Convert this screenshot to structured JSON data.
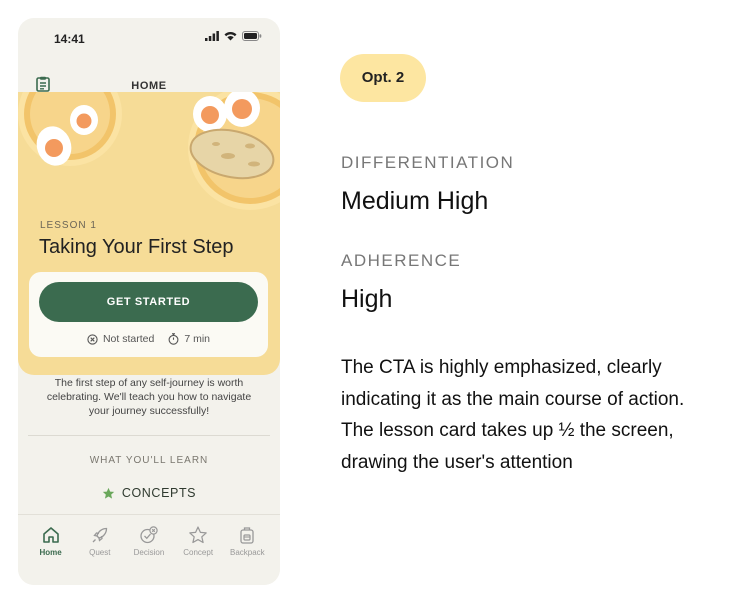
{
  "phone": {
    "status_bar": {
      "time": "14:41"
    },
    "app_bar": {
      "title": "HOME"
    },
    "lesson": {
      "label": "LESSON 1",
      "title": "Taking Your First Step",
      "cta_label": "GET STARTED",
      "status": "Not started",
      "duration": "7 min"
    },
    "description": "The first step of any self-journey is worth celebrating. We'll teach you how to navigate your journey successfully!",
    "learn_heading": "WHAT YOU'LL LEARN",
    "concepts_label": "CONCEPTS",
    "tabs": [
      {
        "label": "Home",
        "icon": "home-icon",
        "active": true
      },
      {
        "label": "Quest",
        "icon": "rocket-icon",
        "active": false
      },
      {
        "label": "Decision",
        "icon": "decision-icon",
        "active": false
      },
      {
        "label": "Concept",
        "icon": "star-icon",
        "active": false
      },
      {
        "label": "Backpack",
        "icon": "backpack-icon",
        "active": false
      }
    ],
    "colors": {
      "primary": "#3b6b4f",
      "hero_bg": "#f6dc97",
      "star": "#6aa75b"
    }
  },
  "panel": {
    "badge": "Opt. 2",
    "differentiation_heading": "DIFFERENTIATION",
    "differentiation_value": "Medium High",
    "adherence_heading": "ADHERENCE",
    "adherence_value": "High",
    "body": "The CTA is highly emphasized, clearly indicating it as the main course of action. The lesson card takes up ½ the screen, drawing the user's attention",
    "badge_color": "#fde6a1"
  }
}
